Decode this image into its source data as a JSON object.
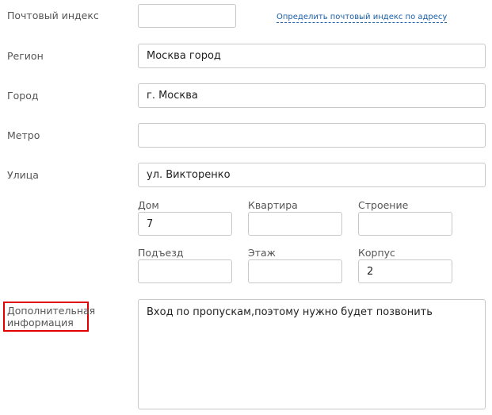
{
  "fields": {
    "postal": {
      "label": "Почтовый индекс",
      "value": "",
      "link": "Определить почтовый индекс по адресу"
    },
    "region": {
      "label": "Регион",
      "value": "Москва город"
    },
    "city": {
      "label": "Город",
      "value": "г. Москва"
    },
    "metro": {
      "label": "Метро",
      "value": ""
    },
    "street": {
      "label": "Улица",
      "value": "ул. Викторенко"
    },
    "house": {
      "label": "Дом",
      "value": "7"
    },
    "apartment": {
      "label": "Квартира",
      "value": ""
    },
    "building": {
      "label": "Строение",
      "value": ""
    },
    "entrance": {
      "label": "Подъезд",
      "value": ""
    },
    "floor": {
      "label": "Этаж",
      "value": ""
    },
    "block": {
      "label": "Корпус",
      "value": "2"
    },
    "extra": {
      "label_line1": "Дополнительная",
      "label_line2": "информация",
      "value": "Вход по пропускам,поэтому нужно будет позвонить"
    }
  },
  "colors": {
    "highlight": "#e00000",
    "link": "#1a5fa8",
    "border": "#c8c8c8"
  }
}
